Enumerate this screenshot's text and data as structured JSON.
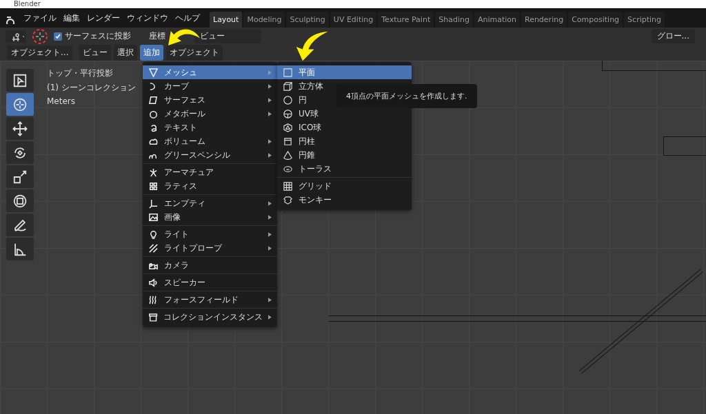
{
  "window": {
    "title": "Blender"
  },
  "menubar": [
    "ファイル",
    "編集",
    "レンダー",
    "ウィンドウ",
    "ヘルプ"
  ],
  "workspaces": [
    {
      "label": "Layout",
      "selected": true
    },
    {
      "label": "Modeling",
      "selected": false
    },
    {
      "label": "Sculpting",
      "selected": false
    },
    {
      "label": "UV Editing",
      "selected": false
    },
    {
      "label": "Texture Paint",
      "selected": false
    },
    {
      "label": "Shading",
      "selected": false
    },
    {
      "label": "Animation",
      "selected": false
    },
    {
      "label": "Rendering",
      "selected": false
    },
    {
      "label": "Compositing",
      "selected": false
    },
    {
      "label": "Scripting",
      "selected": false
    }
  ],
  "tool_settings": {
    "project_surface": {
      "label": "サーフェスに投影",
      "checked": true
    },
    "orientation_label": "座標",
    "orientation_value": "ビュー",
    "transform": "グロー..."
  },
  "header": {
    "mode": "オブジェクト...",
    "menus": [
      {
        "label": "ビュー",
        "selected": false
      },
      {
        "label": "選択",
        "selected": false
      },
      {
        "label": "追加",
        "selected": true
      },
      {
        "label": "オブジェクト",
        "selected": false
      }
    ]
  },
  "toolbar": [
    {
      "selected": false
    },
    {
      "selected": true
    },
    {
      "selected": false
    },
    {
      "selected": false
    },
    {
      "selected": false
    },
    {
      "selected": false
    },
    {
      "selected": false
    },
    {
      "selected": false
    }
  ],
  "overlay": [
    "トップ・平行投影",
    "(1) シーンコレクション",
    "Meters"
  ],
  "add_menu": [
    [
      {
        "label": "メッシュ",
        "submenu": true,
        "selected": true
      },
      {
        "label": "カーブ",
        "submenu": true,
        "selected": false
      },
      {
        "label": "サーフェス",
        "submenu": true,
        "selected": false
      },
      {
        "label": "メタボール",
        "submenu": true,
        "selected": false
      },
      {
        "label": "テキスト",
        "submenu": false,
        "selected": false
      },
      {
        "label": "ボリューム",
        "submenu": true,
        "selected": false
      },
      {
        "label": "グリースペンシル",
        "submenu": true,
        "selected": false
      }
    ],
    [
      {
        "label": "アーマチュア",
        "submenu": false,
        "selected": false
      },
      {
        "label": "ラティス",
        "submenu": false,
        "selected": false
      }
    ],
    [
      {
        "label": "エンプティ",
        "submenu": true,
        "selected": false
      },
      {
        "label": "画像",
        "submenu": true,
        "selected": false
      }
    ],
    [
      {
        "label": "ライト",
        "submenu": true,
        "selected": false
      },
      {
        "label": "ライトプローブ",
        "submenu": true,
        "selected": false
      }
    ],
    [
      {
        "label": "カメラ",
        "submenu": false,
        "selected": false
      }
    ],
    [
      {
        "label": "スピーカー",
        "submenu": false,
        "selected": false
      }
    ],
    [
      {
        "label": "フォースフィールド",
        "submenu": true,
        "selected": false
      }
    ],
    [
      {
        "label": "コレクションインスタンス",
        "submenu": true,
        "selected": false
      }
    ]
  ],
  "mesh_menu": [
    [
      {
        "label": "平面",
        "selected": true
      },
      {
        "label": "立方体",
        "selected": false
      },
      {
        "label": "円",
        "selected": false
      },
      {
        "label": "UV球",
        "selected": false
      },
      {
        "label": "ICO球",
        "selected": false
      },
      {
        "label": "円柱",
        "selected": false
      },
      {
        "label": "円錐",
        "selected": false
      },
      {
        "label": "トーラス",
        "selected": false
      }
    ],
    [
      {
        "label": "グリッド",
        "selected": false
      },
      {
        "label": "モンキー",
        "selected": false
      }
    ]
  ],
  "tooltip": "4頂点の平面メッシュを作成します."
}
